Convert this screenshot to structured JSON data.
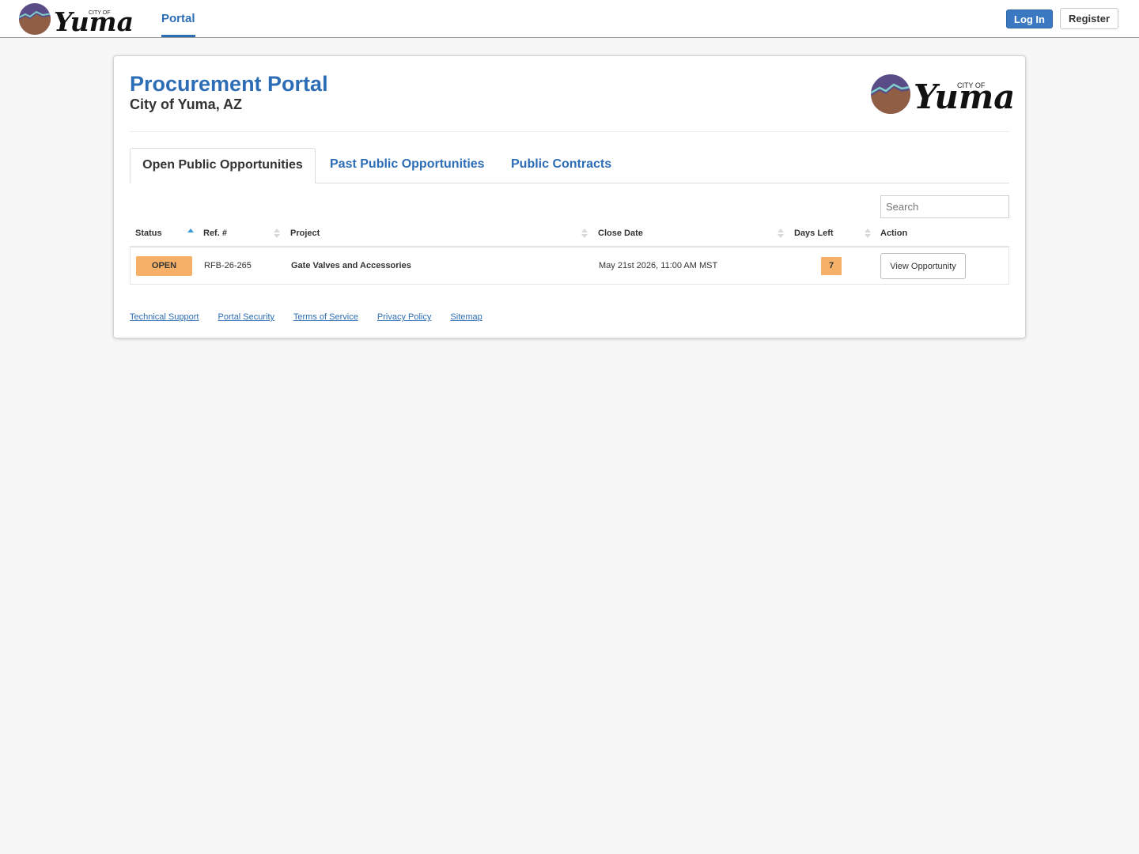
{
  "nav": {
    "logo_text": [
      "CITY OF",
      "Yuma"
    ],
    "portal_link": "Portal",
    "login_label": "Log In",
    "register_label": "Register"
  },
  "header": {
    "title": "Procurement Portal",
    "subtitle": "City of Yuma, AZ",
    "logo_text": [
      "CITY OF",
      "Yuma"
    ]
  },
  "tabs": [
    {
      "label": "Open Public Opportunities",
      "active": true
    },
    {
      "label": "Past Public Opportunities",
      "active": false
    },
    {
      "label": "Public Contracts",
      "active": false
    }
  ],
  "search": {
    "placeholder": "Search",
    "value": ""
  },
  "table": {
    "columns": [
      {
        "label": "Status",
        "sort": "ascending"
      },
      {
        "label": "Ref. #",
        "sort": "none"
      },
      {
        "label": "Project",
        "sort": "none"
      },
      {
        "label": "Close Date",
        "sort": "none"
      },
      {
        "label": "Days Left",
        "sort": "none"
      },
      {
        "label": "Action",
        "sort": null
      }
    ],
    "rows": [
      {
        "status": "OPEN",
        "ref": "RFB-26-265",
        "project": "Gate Valves and Accessories",
        "close_date": "May 21st 2026, 11:00 AM MST",
        "days_left": "7",
        "action_label": "View Opportunity"
      }
    ]
  },
  "footer": {
    "links": [
      "Technical Support",
      "Portal Security",
      "Terms of Service",
      "Privacy Policy",
      "Sitemap"
    ]
  },
  "colors": {
    "accent_blue": "#2d6db5",
    "login_button": "#3a78c2",
    "status_open": "#f6b068",
    "page_background": "#f7f7f7"
  }
}
